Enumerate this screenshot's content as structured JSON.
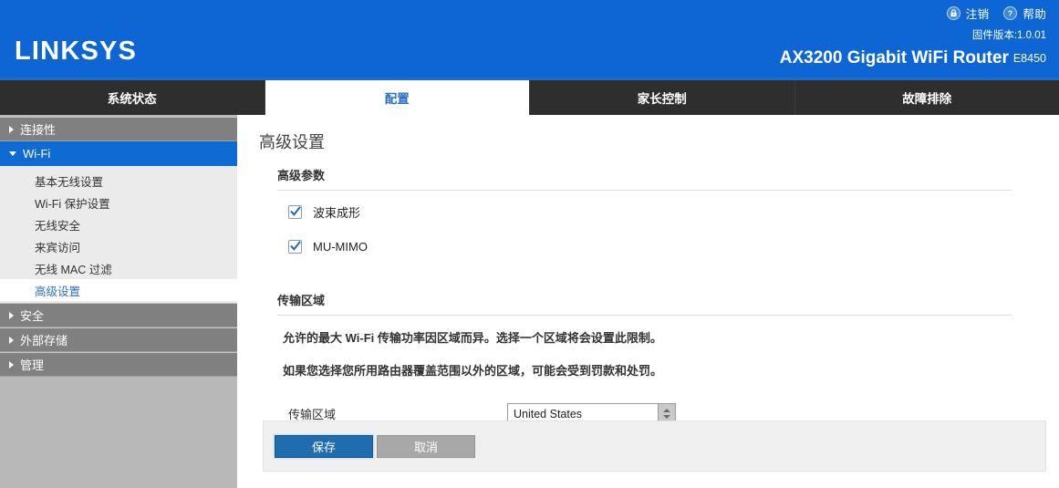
{
  "topbar": {
    "items": [
      {
        "icon": "lock-icon",
        "label": "注销"
      },
      {
        "icon": "help-icon",
        "label": "帮助"
      }
    ]
  },
  "brand": {
    "logo": "LINKSYS",
    "firmware": "固件版本:1.0.01",
    "model": "AX3200 Gigabit WiFi Router",
    "sku": "E8450"
  },
  "tabs": [
    {
      "label": "系统状态",
      "active": false
    },
    {
      "label": "配置",
      "active": true
    },
    {
      "label": "家长控制",
      "active": false
    },
    {
      "label": "故障排除",
      "active": false
    }
  ],
  "sidebar": {
    "groups": [
      {
        "label": "连接性",
        "state": "collapsed",
        "active": false
      },
      {
        "label": "Wi-Fi",
        "state": "expanded",
        "active": true
      },
      {
        "label": "安全",
        "state": "collapsed",
        "active": false
      },
      {
        "label": "外部存储",
        "state": "collapsed",
        "active": false
      },
      {
        "label": "管理",
        "state": "collapsed",
        "active": false
      }
    ],
    "wifi_items": [
      {
        "label": "基本无线设置",
        "active": false
      },
      {
        "label": "Wi-Fi 保护设置",
        "active": false
      },
      {
        "label": "无线安全",
        "active": false
      },
      {
        "label": "来宾访问",
        "active": false
      },
      {
        "label": "无线 MAC 过滤",
        "active": false
      },
      {
        "label": "高级设置",
        "active": true
      }
    ]
  },
  "main": {
    "page_title": "高级设置",
    "section_params": "高级参数",
    "checkboxes": [
      {
        "label": "波束成形",
        "checked": true
      },
      {
        "label": "MU-MIMO",
        "checked": true
      }
    ],
    "section_region": "传输区域",
    "desc_line1": "允许的最大 Wi-Fi 传输功率因区域而异。选择一个区域将会设置此限制。",
    "desc_line2": "如果您选择您所用路由器覆盖范围以外的区域，可能会受到罚款和处罚。",
    "field_label": "传输区域",
    "region_value": "United States",
    "buttons": {
      "save": "保存",
      "cancel": "取消"
    }
  },
  "colors": {
    "brand_blue": "#0d66d4",
    "tab_dark": "#2e2e2e",
    "active_blue": "#0f6ad4",
    "sidebar_gray": "#808080",
    "save_blue": "#1f6cb0",
    "cancel_gray": "#a8a8a8"
  }
}
